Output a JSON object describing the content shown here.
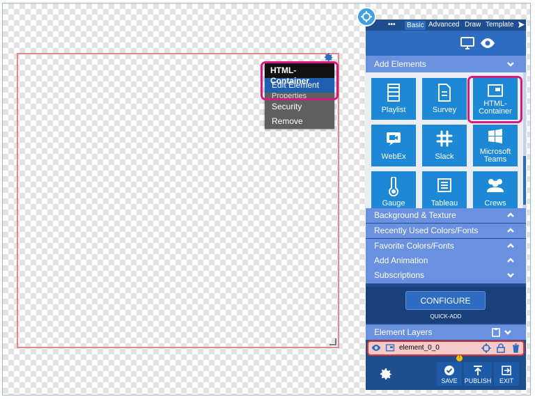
{
  "canvas": {
    "context_menu": {
      "header": "HTML-Container",
      "items": [
        "Edit Element",
        "Properties",
        "Security",
        "Remove"
      ]
    }
  },
  "panel": {
    "tabs": {
      "more": "•••",
      "basic": "Basic",
      "advanced": "Advanced",
      "draw": "Draw",
      "template": "Template"
    },
    "add_elements": {
      "title": "Add Elements",
      "tiles": [
        {
          "label": "Playlist",
          "icon": "film-icon"
        },
        {
          "label": "Survey",
          "icon": "document-icon"
        },
        {
          "label": "HTML-\nContainer",
          "icon": "html-container-icon"
        },
        {
          "label": "WebEx",
          "icon": "webex-icon"
        },
        {
          "label": "Slack",
          "icon": "slack-icon"
        },
        {
          "label": "Microsoft\nTeams",
          "icon": "windows-icon"
        },
        {
          "label": "Gauge",
          "icon": "thermometer-icon"
        },
        {
          "label": "Tableau",
          "icon": "tableau-icon"
        },
        {
          "label": "Crews",
          "icon": "people-icon"
        }
      ]
    },
    "sections": [
      {
        "title": "Background & Texture",
        "state": "up"
      },
      {
        "title": "Recently Used Colors/Fonts",
        "state": "up"
      },
      {
        "title": "Favorite Colors/Fonts",
        "state": "up"
      },
      {
        "title": "Add Animation",
        "state": "up"
      },
      {
        "title": "Subscriptions",
        "state": "down"
      }
    ],
    "configure_label": "CONFIGURE",
    "quick_add_label": "QUICK-ADD",
    "layers": {
      "title": "Element Layers",
      "rows": [
        {
          "name": "element_0_0"
        }
      ]
    },
    "bottom_buttons": {
      "save": "SAVE",
      "publish": "PUBLISH",
      "exit": "EXIT"
    },
    "save_badge": "!"
  },
  "colors": {
    "accent": "#1f4e8f",
    "highlight": "#d6187f",
    "tile": "#1d88d6"
  }
}
